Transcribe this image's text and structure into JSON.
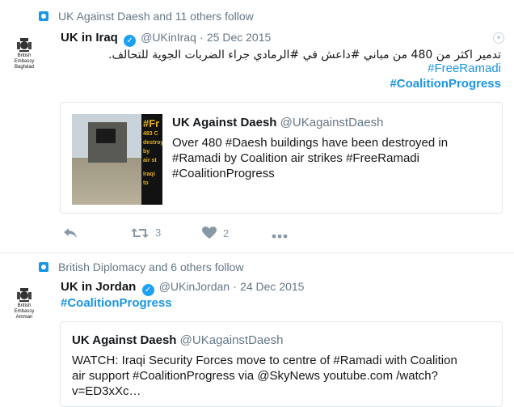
{
  "tweets": [
    {
      "social": "UK Against Daesh and 11 others follow",
      "avatar_caption": [
        "British Embassy",
        "Baghdad"
      ],
      "name": "UK in Iraq",
      "handle": "@UKinIraq",
      "dot": "·",
      "date": "25 Dec 2015",
      "text_arabic": "تدمير اكثر من 480 من مباني #داعش في #الرمادي جراء الضربات الجوية للتحالف.",
      "hashtags": [
        "#FreeRamadi",
        "#CoalitionProgress"
      ],
      "quote": {
        "name": "UK Against Daesh",
        "handle": "@UKagainstDaesh",
        "text": "Over 480 #Daesh buildings have been destroyed in #Ramadi by Coalition air strikes #FreeRamadi #CoalitionProgress",
        "media_overlay": [
          "#Fr",
          "483 C",
          "destroyed",
          "by",
          "air st",
          "Iraqi",
          "to"
        ]
      },
      "actions": {
        "retweets": "3",
        "likes": "2"
      }
    },
    {
      "social": "British Diplomacy and 6 others follow",
      "avatar_caption": [
        "British Embassy",
        "Amman"
      ],
      "name": "UK in Jordan",
      "handle": "@UKinJordan",
      "dot": "·",
      "date": "24 Dec 2015",
      "hashtag": "#CoalitionProgress",
      "quote": {
        "name": "UK Against Daesh",
        "handle": "@UKagainstDaesh",
        "text": "WATCH: Iraqi Security Forces move to centre of #Ramadi with Coalition air support #CoalitionProgress via @SkyNews  youtube.com /watch?v=ED3xXc…"
      }
    }
  ],
  "colors": {
    "link": "#1b95e0",
    "verified": "#1da1f2",
    "secondary": "#657786"
  },
  "icons": [
    "reply-icon",
    "retweet-icon",
    "heart-icon",
    "more-icon",
    "verified-icon",
    "caret-down-icon"
  ]
}
